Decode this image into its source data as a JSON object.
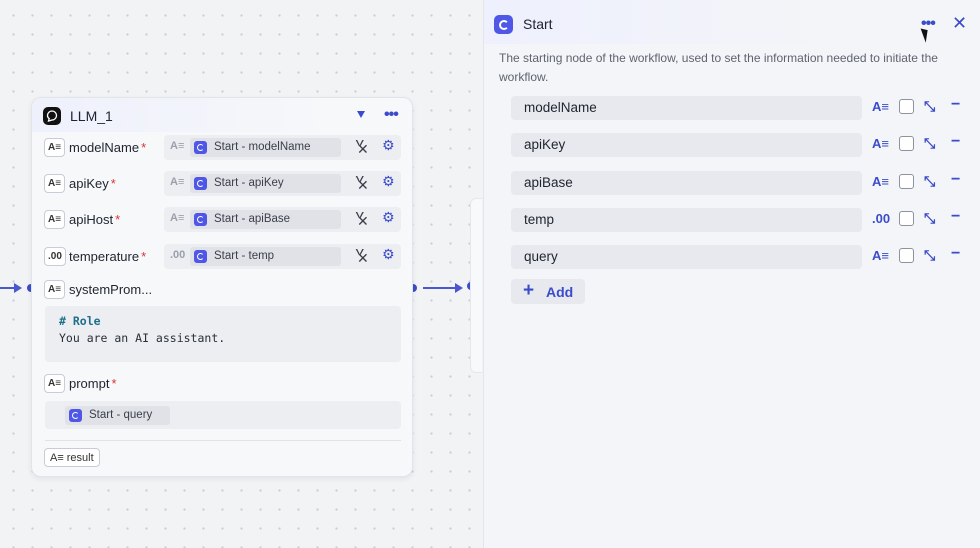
{
  "llm_node": {
    "title": "LLM_1",
    "params": [
      {
        "type_icon": "A≡",
        "label": "modelName",
        "required": "*",
        "ref_type": "A≡",
        "ref": "Start - modelName"
      },
      {
        "type_icon": "A≡",
        "label": "apiKey",
        "required": "*",
        "ref_type": "A≡",
        "ref": "Start - apiKey"
      },
      {
        "type_icon": "A≡",
        "label": "apiHost",
        "required": "*",
        "ref_type": "A≡",
        "ref": "Start - apiBase"
      },
      {
        "type_icon": ".00",
        "label": "temperature",
        "required": "*",
        "ref_type": ".00",
        "ref": "Start - temp"
      }
    ],
    "system_prompt": {
      "type_icon": "A≡",
      "label": "systemProm...",
      "code_line1": "# Role",
      "code_line2": "You are an AI assistant."
    },
    "prompt": {
      "type_icon": "A≡",
      "label": "prompt",
      "required": "*",
      "ref": "Start - query"
    },
    "output": {
      "type_icon": "A≡",
      "label": "result"
    }
  },
  "start_panel": {
    "title": "Start",
    "description": "The starting node of the workflow, used to set the information needed to initiate the workflow.",
    "fields": [
      {
        "name": "modelName",
        "type_icon": "A≡"
      },
      {
        "name": "apiKey",
        "type_icon": "A≡"
      },
      {
        "name": "apiBase",
        "type_icon": "A≡"
      },
      {
        "name": "temp",
        "type_icon": ".00"
      },
      {
        "name": "query",
        "type_icon": "A≡"
      }
    ],
    "add_label": "Add"
  },
  "icons": {
    "more": "more-horizontal-icon",
    "close": "close-icon",
    "caret": "caret-down-icon",
    "chevron": "chevron-down-icon",
    "gear": "gear-icon",
    "expand": "expand-icon",
    "remove": "minus-icon"
  },
  "colors": {
    "accent": "#3b4cca",
    "reference_tag": "#4f57e6",
    "required": "#d9343a"
  }
}
